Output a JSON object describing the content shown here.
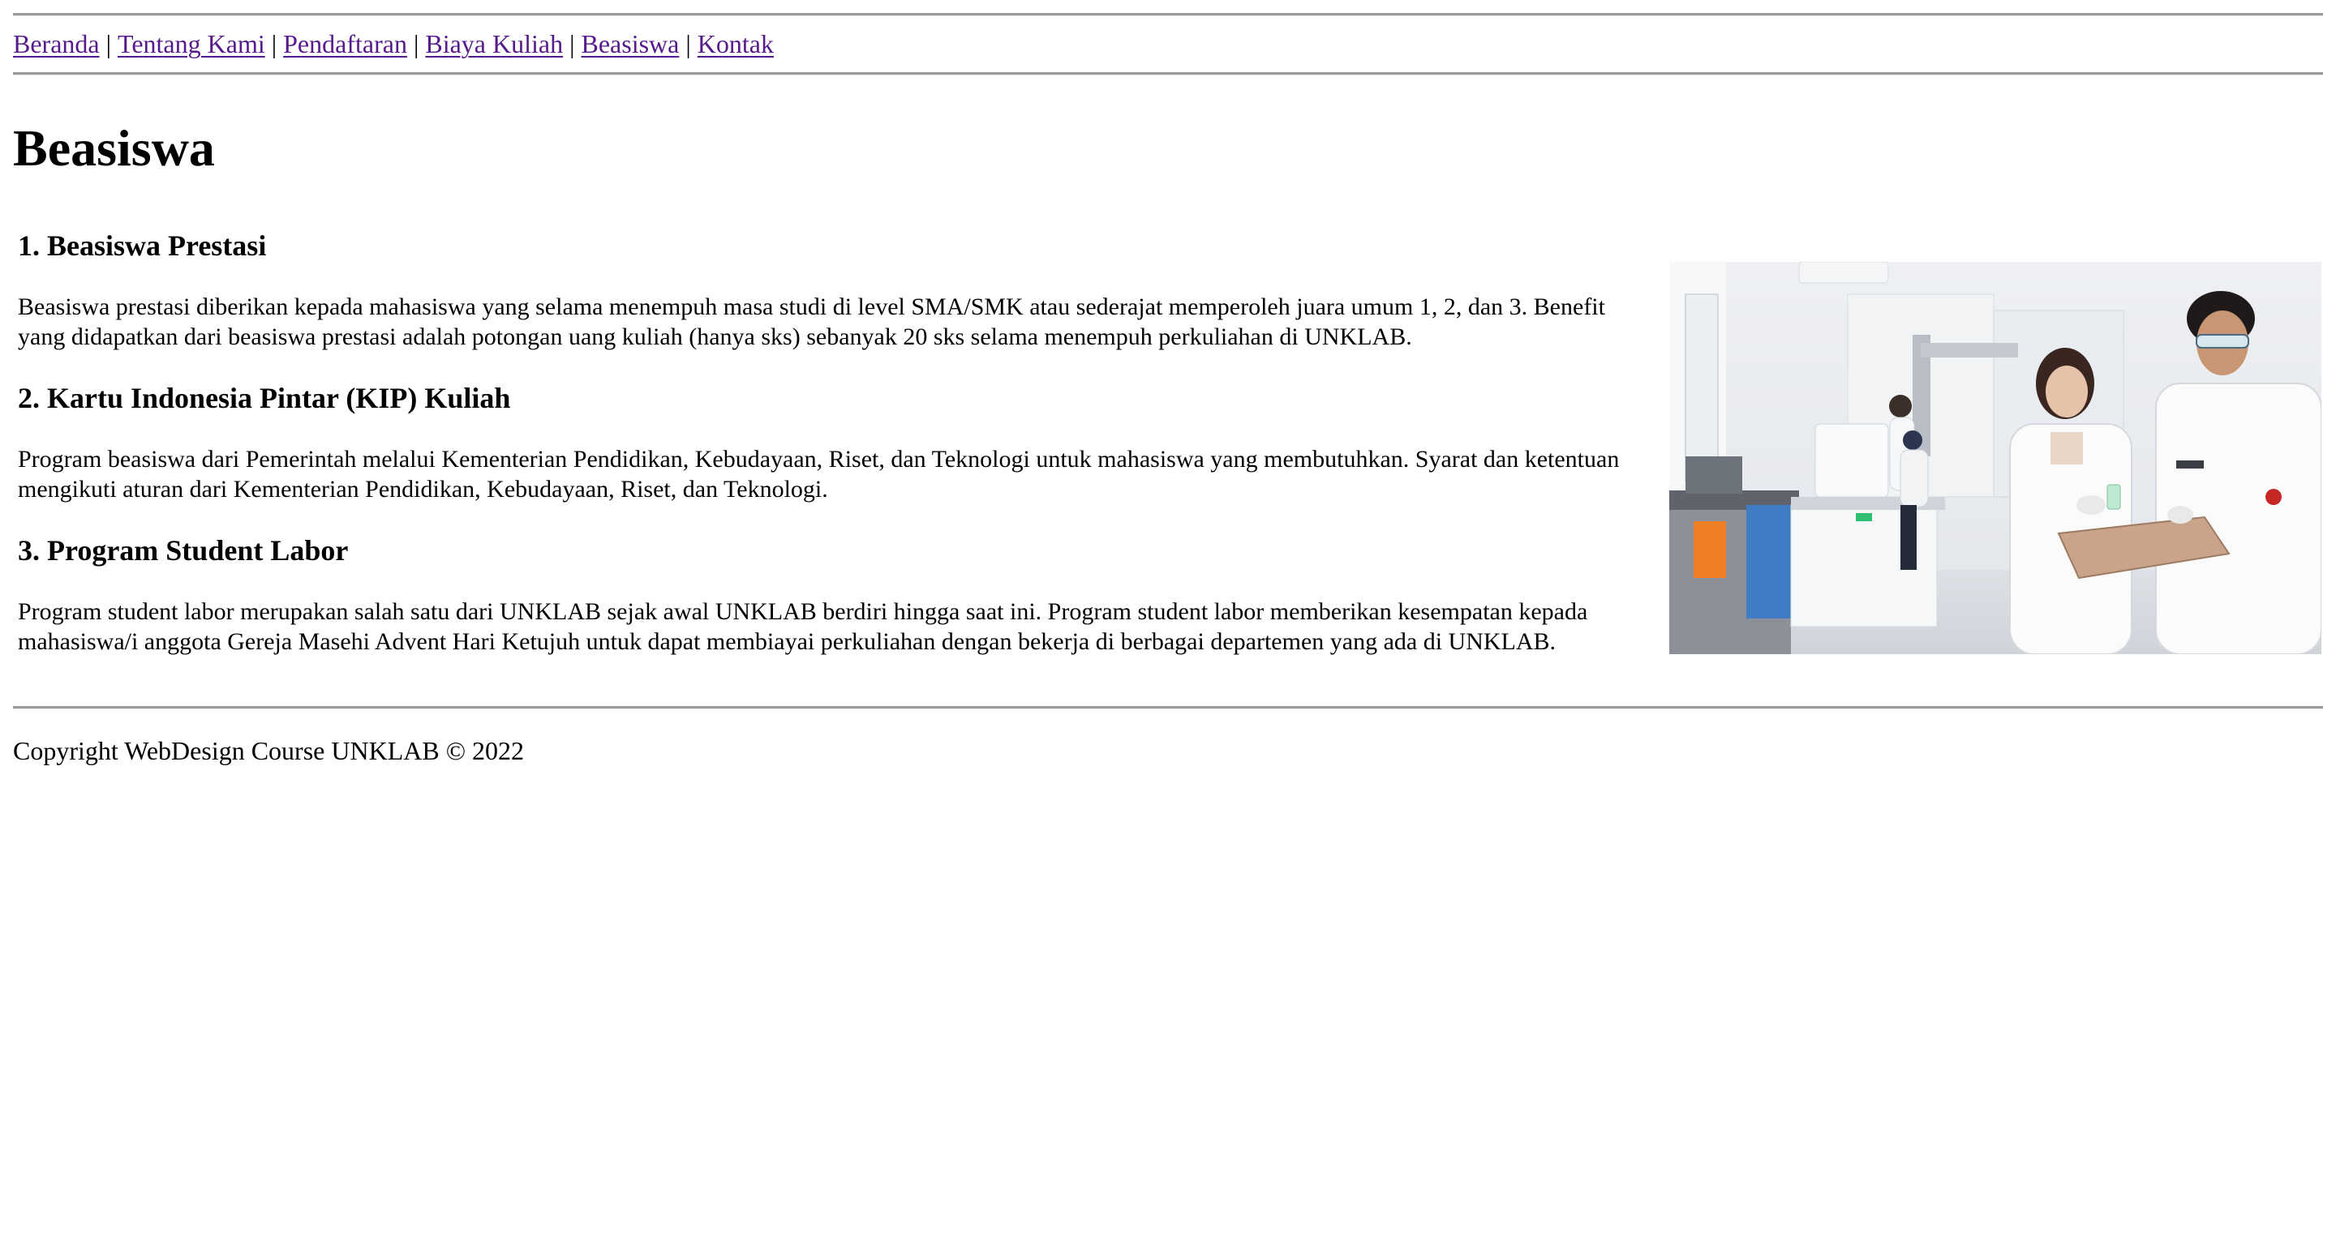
{
  "nav": {
    "links": [
      {
        "label": "Beranda"
      },
      {
        "label": "Tentang Kami"
      },
      {
        "label": "Pendaftaran"
      },
      {
        "label": "Biaya Kuliah"
      },
      {
        "label": "Beasiswa"
      },
      {
        "label": "Kontak"
      }
    ],
    "separator": "|"
  },
  "page": {
    "title": "Beasiswa"
  },
  "sections": [
    {
      "heading": "1. Beasiswa Prestasi",
      "body": "Beasiswa prestasi diberikan kepada mahasiswa yang selama menempuh masa studi di level SMA/SMK atau sederajat memperoleh juara umum 1, 2, dan 3. Benefit yang didapatkan dari beasiswa prestasi adalah potongan uang kuliah (hanya sks) sebanyak 20 sks selama menempuh perkuliahan di UNKLAB."
    },
    {
      "heading": "2. Kartu Indonesia Pintar (KIP) Kuliah",
      "body": "Program beasiswa dari Pemerintah melalui Kementerian Pendidikan, Kebudayaan, Riset, dan Teknologi untuk mahasiswa yang membutuhkan. Syarat dan ketentuan mengikuti aturan dari Kementerian Pendidikan, Kebudayaan, Riset, dan Teknologi."
    },
    {
      "heading": "3. Program Student Labor",
      "body": "Program student labor merupakan salah satu dari UNKLAB sejak awal UNKLAB berdiri hingga saat ini. Program student labor memberikan kesempatan kepada mahasiswa/i anggota Gereja Masehi Advent Hari Ketujuh untuk dapat membiayai perkuliahan dengan bekerja di berbagai departemen yang ada di UNKLAB."
    }
  ],
  "footer": {
    "copyright": "Copyright WebDesign Course UNKLAB © 2022"
  },
  "image": {
    "icon": "laboratory-students-photo"
  }
}
